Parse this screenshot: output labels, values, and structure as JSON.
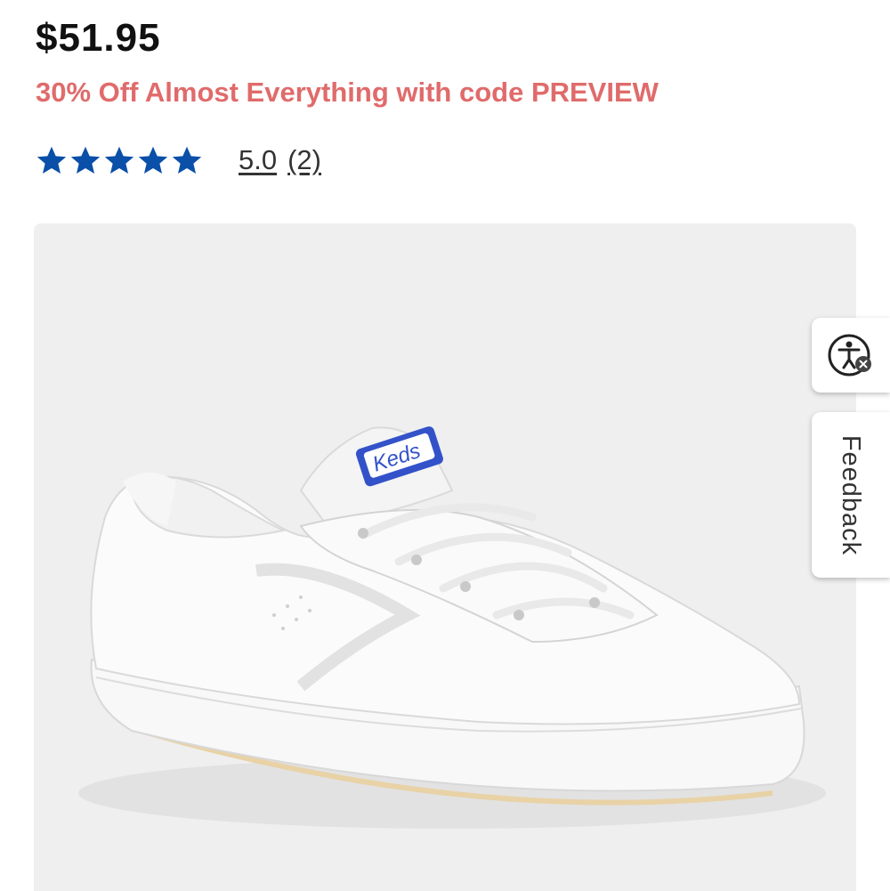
{
  "product": {
    "price": "$51.95",
    "promo": "30% Off Almost Everything with code PREVIEW",
    "rating": {
      "stars": 5,
      "max_stars": 5,
      "score_label": "5.0",
      "count_label": "(2)"
    },
    "image": {
      "brand_label": "Keds",
      "icon": "white-sneaker-image"
    }
  },
  "side_tabs": {
    "accessibility_icon": "accessibility-icon",
    "feedback_label": "Feedback"
  },
  "colors": {
    "price": "#111111",
    "promo": "#e06b6b",
    "star": "#0a4fa8",
    "image_bg": "#efefef"
  }
}
